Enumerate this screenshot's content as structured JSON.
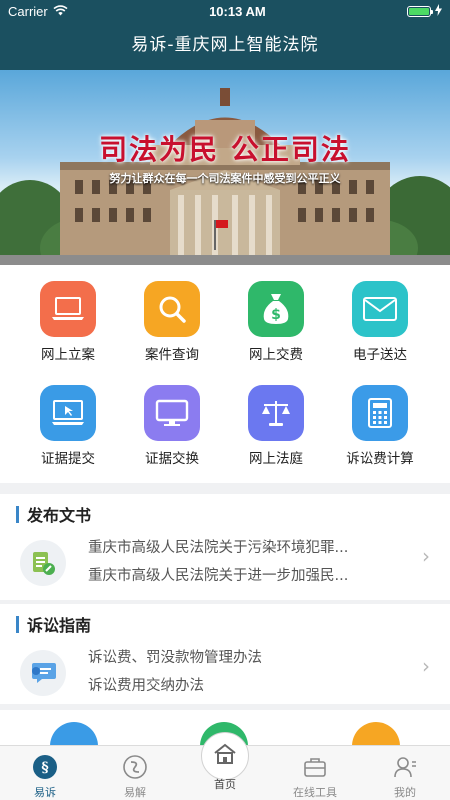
{
  "status_bar": {
    "carrier": "Carrier",
    "time": "10:13 AM"
  },
  "header": {
    "title": "易诉-重庆网上智能法院"
  },
  "banner": {
    "title": "司法为民 公正司法",
    "subtitle": "努力让群众在每一个司法案件中感受到公平正义"
  },
  "services": [
    {
      "label": "网上立案",
      "icon": "laptop-icon",
      "color": "#f36e4b"
    },
    {
      "label": "案件查询",
      "icon": "search-icon",
      "color": "#f6a623"
    },
    {
      "label": "网上交费",
      "icon": "money-bag-icon",
      "color": "#2fb86a"
    },
    {
      "label": "电子送达",
      "icon": "envelope-icon",
      "color": "#2cc3c9"
    },
    {
      "label": "证据提交",
      "icon": "evidence-upload-icon",
      "color": "#3a9be6"
    },
    {
      "label": "证据交换",
      "icon": "monitor-icon",
      "color": "#8b7cf0"
    },
    {
      "label": "网上法庭",
      "icon": "scales-icon",
      "color": "#6b78f0"
    },
    {
      "label": "诉讼费计算",
      "icon": "calculator-icon",
      "color": "#3b9be8"
    }
  ],
  "docs": {
    "title": "发布文书",
    "items": [
      "重庆市高级人民法院关于污染环境犯罪...",
      "重庆市高级人民法院关于进一步加强民..."
    ]
  },
  "guide": {
    "title": "诉讼指南",
    "items": [
      "诉讼费、罚没款物管理办法",
      "诉讼费用交纳办法"
    ]
  },
  "tabs": {
    "yisu": "易诉",
    "yijie": "易解",
    "home": "首页",
    "tools": "在线工具",
    "mine": "我的"
  }
}
